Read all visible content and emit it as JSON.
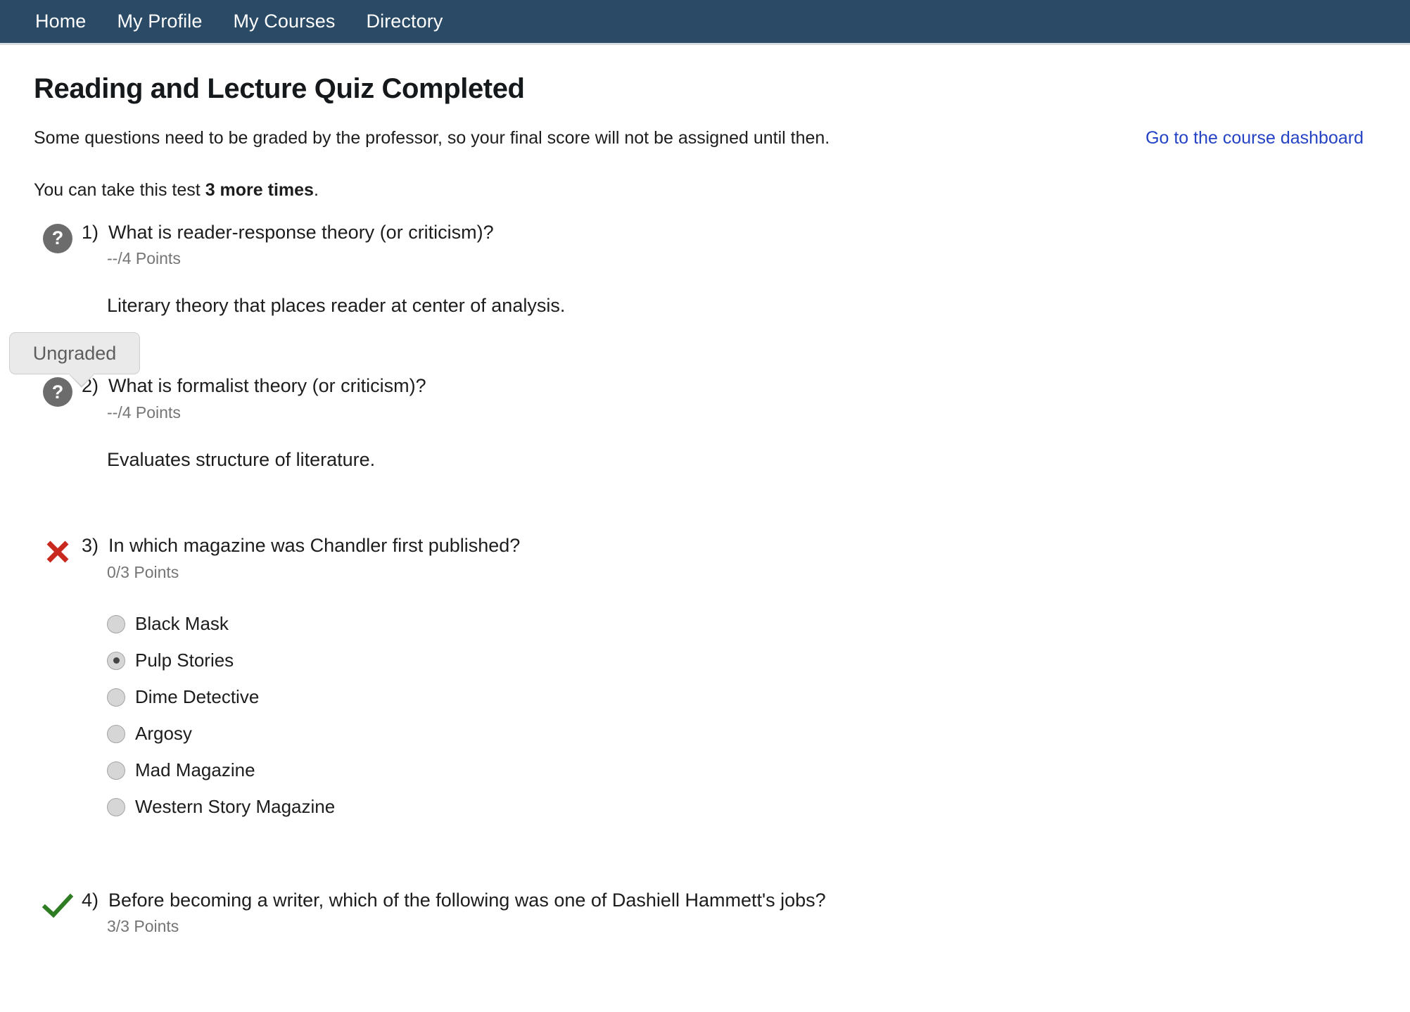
{
  "nav": {
    "items": [
      {
        "label": "Home"
      },
      {
        "label": "My Profile"
      },
      {
        "label": "My Courses"
      },
      {
        "label": "Directory"
      }
    ]
  },
  "header": {
    "title": "Reading and Lecture Quiz Completed",
    "notice": "Some questions need to be graded by the professor, so your final score will not be assigned until then.",
    "dashboard_link": "Go to the course dashboard",
    "attempts_prefix": "You can take this test ",
    "attempts_count": "3 more times",
    "attempts_suffix": "."
  },
  "tooltip": {
    "label": "Ungraded"
  },
  "colors": {
    "navbar": "#2a4a66",
    "link": "#2442c4",
    "incorrect": "#c8281e",
    "correct": "#2e7d22",
    "ungraded_icon": "#6c6c6c",
    "points_text": "#757575",
    "tooltip_bg": "#eaeaea",
    "tooltip_border": "#cfcfcf"
  },
  "questions": [
    {
      "status": "ungraded",
      "status_icon": "question-mark-icon",
      "number": "1)",
      "text": "What is reader-response theory (or criticism)?",
      "points": "--/4 Points",
      "answer": "Literary theory that places reader at center of analysis.",
      "choices": []
    },
    {
      "status": "ungraded",
      "status_icon": "question-mark-icon",
      "number": "2)",
      "text": "What is formalist theory (or criticism)?",
      "points": "--/4 Points",
      "answer": "Evaluates structure of literature.",
      "choices": []
    },
    {
      "status": "incorrect",
      "status_icon": "x-mark-icon",
      "number": "3)",
      "text": "In which magazine was Chandler first published?",
      "points": "0/3 Points",
      "answer": "",
      "choices": [
        {
          "label": "Black Mask",
          "selected": false
        },
        {
          "label": "Pulp Stories",
          "selected": true
        },
        {
          "label": "Dime Detective",
          "selected": false
        },
        {
          "label": "Argosy",
          "selected": false
        },
        {
          "label": "Mad Magazine",
          "selected": false
        },
        {
          "label": "Western Story Magazine",
          "selected": false
        }
      ]
    },
    {
      "status": "correct",
      "status_icon": "check-mark-icon",
      "number": "4)",
      "text": "Before becoming a writer, which of the following was one of Dashiell Hammett's jobs?",
      "points": "3/3 Points",
      "answer": "",
      "choices": []
    }
  ]
}
